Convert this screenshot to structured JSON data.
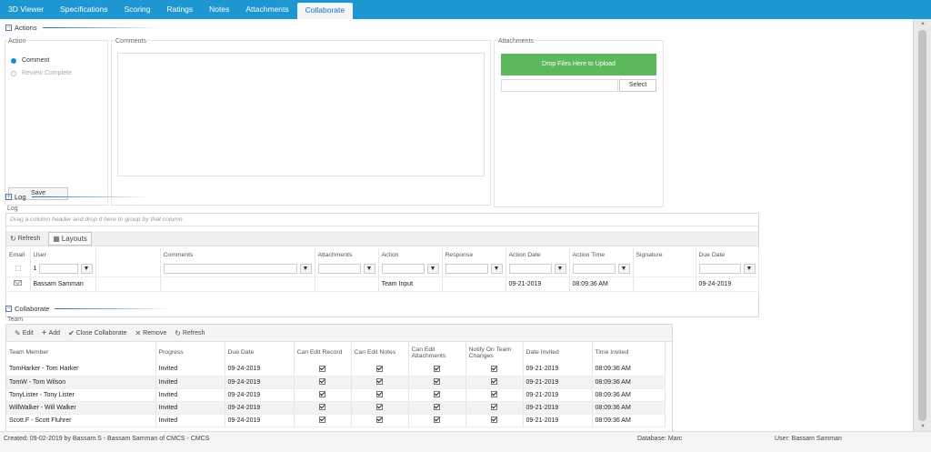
{
  "tabs": [
    {
      "label": "3D Viewer",
      "active": false
    },
    {
      "label": "Specifications",
      "active": false
    },
    {
      "label": "Scoring",
      "active": false
    },
    {
      "label": "Ratings",
      "active": false
    },
    {
      "label": "Notes",
      "active": false
    },
    {
      "label": "Attachments",
      "active": false
    },
    {
      "label": "Collaborate",
      "active": true
    }
  ],
  "actions": {
    "section_title": "Actions",
    "action_group_label": "Action",
    "radio_comment": "Comment",
    "radio_review_complete": "Review Complete",
    "save_label": "Save",
    "comments_label": "Comments",
    "attachments_label": "Attachments",
    "drop_label": "Drop Files Here to Upload",
    "select_label": "Select"
  },
  "log": {
    "section_title": "Log",
    "group_label": "Log",
    "group_hint": "Drag a column header and drop it here to group by that column",
    "refresh_label": "Refresh",
    "layouts_label": "Layouts",
    "columns": [
      "Email",
      "User",
      "",
      "Comments",
      "Attachments",
      "Action",
      "Response",
      "Action Date",
      "Action Time",
      "Signature",
      "Due Date"
    ],
    "filter_row_value": "1",
    "rows": [
      {
        "user": "Bassam Samman",
        "comments": "",
        "attachments": "",
        "action": "Team Input",
        "response": "",
        "action_date": "09-21-2019",
        "action_time": "08:09:36 AM",
        "signature": "",
        "due_date": "09-24-2019"
      }
    ]
  },
  "collaborate": {
    "section_title": "Collaborate",
    "team_label": "Team",
    "toolbar": {
      "edit": "Edit",
      "add": "Add",
      "close": "Close Collaborate",
      "remove": "Remove",
      "refresh": "Refresh"
    },
    "columns": [
      "Team Member",
      "Progress",
      "Due Date",
      "Can Edit Record",
      "Can Edit Notes",
      "Can Edit Attachments",
      "Notify On Team Changes",
      "Date Invited",
      "Time Invited"
    ],
    "rows": [
      {
        "member": "TomHarker - Tom Harker",
        "progress": "Invited",
        "due": "09-24-2019",
        "edit_record": true,
        "edit_notes": true,
        "edit_attachments": true,
        "notify": true,
        "date_invited": "09-21-2019",
        "time_invited": "08:09:36 AM"
      },
      {
        "member": "TomW - Tom Wilson",
        "progress": "Invited",
        "due": "09-24-2019",
        "edit_record": true,
        "edit_notes": true,
        "edit_attachments": true,
        "notify": true,
        "date_invited": "09-21-2019",
        "time_invited": "08:09:36 AM"
      },
      {
        "member": "TonyLister - Tony Lister",
        "progress": "Invited",
        "due": "09-24-2019",
        "edit_record": true,
        "edit_notes": true,
        "edit_attachments": true,
        "notify": true,
        "date_invited": "09-21-2019",
        "time_invited": "08:09:36 AM"
      },
      {
        "member": "WillWalker - Will Walker",
        "progress": "Invited",
        "due": "09-24-2019",
        "edit_record": true,
        "edit_notes": true,
        "edit_attachments": true,
        "notify": true,
        "date_invited": "09-21-2019",
        "time_invited": "08:09:36 AM"
      },
      {
        "member": "Scott.F - Scott Fluhrer",
        "progress": "Invited",
        "due": "09-24-2019",
        "edit_record": true,
        "edit_notes": true,
        "edit_attachments": true,
        "notify": true,
        "date_invited": "09-21-2019",
        "time_invited": "08:09:36 AM"
      }
    ]
  },
  "footer": {
    "created": "Created:   09-02-2019 by Bassam.S - Bassam Samman of CMCS - CMCS",
    "database": "Database:  Marc",
    "user": "User:  Bassam Samman"
  },
  "colors": {
    "tabbar": "#1e96d2",
    "dropzone": "#5cb85c",
    "radio_selected": "#1e88d8"
  }
}
